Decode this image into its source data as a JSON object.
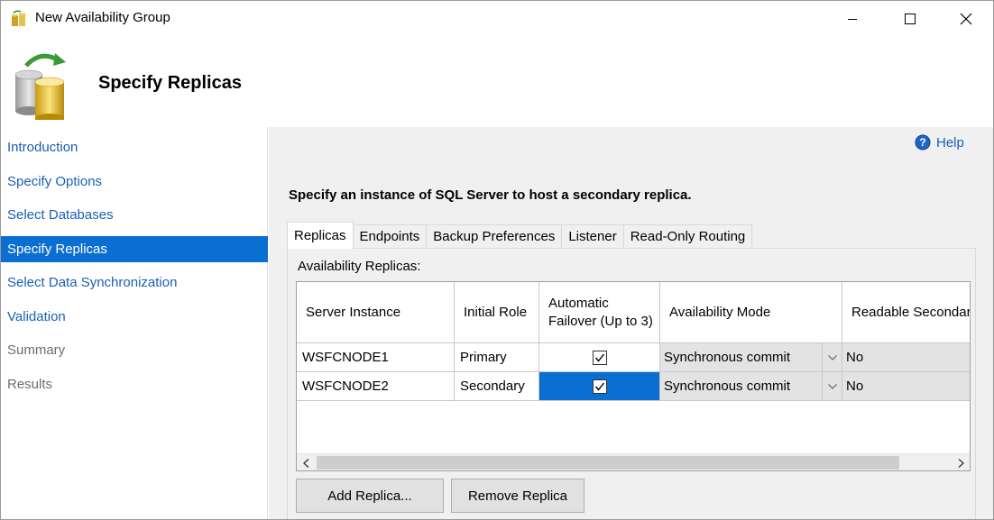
{
  "window": {
    "title": "New Availability Group",
    "buttons": [
      "minimize",
      "maximize",
      "close"
    ]
  },
  "header": {
    "title": "Specify Replicas"
  },
  "sidebar": {
    "items": [
      {
        "label": "Introduction",
        "state": "link"
      },
      {
        "label": "Specify Options",
        "state": "link"
      },
      {
        "label": "Select Databases",
        "state": "link"
      },
      {
        "label": "Specify Replicas",
        "state": "active"
      },
      {
        "label": "Select Data Synchronization",
        "state": "link"
      },
      {
        "label": "Validation",
        "state": "link"
      },
      {
        "label": "Summary",
        "state": "disabled"
      },
      {
        "label": "Results",
        "state": "disabled"
      }
    ]
  },
  "main": {
    "help_label": "Help",
    "instruction": "Specify an instance of SQL Server to host a secondary replica.",
    "tabs": [
      "Replicas",
      "Endpoints",
      "Backup Preferences",
      "Listener",
      "Read-Only Routing"
    ],
    "active_tab": "Replicas",
    "panel_label": "Availability Replicas:",
    "grid": {
      "columns": [
        "Server Instance",
        "Initial Role",
        "Automatic Failover (Up to 3)",
        "Availability Mode",
        "Readable Secondar"
      ],
      "rows": [
        {
          "server": "WSFCNODE1",
          "role": "Primary",
          "failover": true,
          "mode": "Synchronous commit",
          "readable": "No",
          "selected_failover": false
        },
        {
          "server": "WSFCNODE2",
          "role": "Secondary",
          "failover": true,
          "mode": "Synchronous commit",
          "readable": "No",
          "selected_failover": true
        }
      ]
    },
    "buttons": {
      "add": "Add Replica...",
      "remove": "Remove Replica"
    }
  },
  "colors": {
    "selection": "#0a6fd1",
    "link": "#1a5fb4",
    "panel_bg": "#f0f0f0"
  }
}
